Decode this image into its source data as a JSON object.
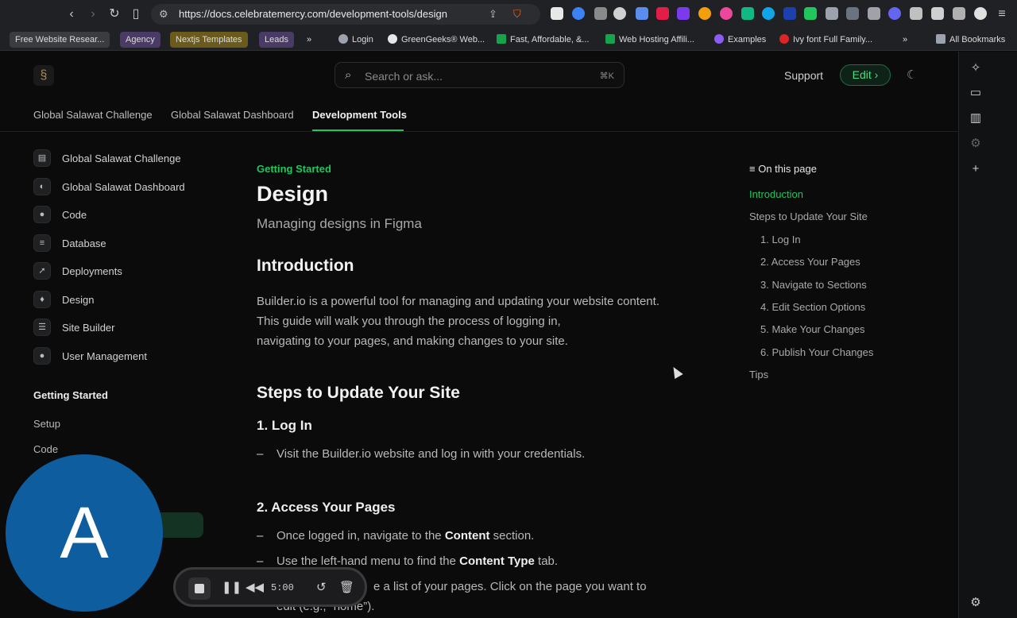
{
  "browser": {
    "url": "https://docs.celebratemercy.com/development-tools/design",
    "bookmarks": [
      {
        "label": "Free Website Resear...",
        "type": "tag",
        "color": "#3b3c40"
      },
      {
        "label": "Agency",
        "type": "tag",
        "color": "#4a3a66"
      },
      {
        "label": "Nextjs Templates",
        "type": "tag",
        "color": "#6a5a1c"
      },
      {
        "label": "Leads",
        "type": "tag",
        "color": "#4a3a66"
      },
      {
        "label": "Login",
        "type": "link",
        "icon": "globe-icon"
      },
      {
        "label": "GreenGeeks® Web...",
        "type": "link",
        "icon": "google-icon"
      },
      {
        "label": "Fast, Affordable, &...",
        "type": "link",
        "icon": "plus-green-icon"
      },
      {
        "label": "Web Hosting Affili...",
        "type": "link",
        "icon": "plus-green-icon"
      },
      {
        "label": "Examples",
        "type": "link",
        "icon": "purple-circle-icon"
      },
      {
        "label": "Ivy font Full Family...",
        "type": "link",
        "icon": "star-red-icon"
      },
      {
        "label": "All Bookmarks",
        "type": "folder"
      }
    ]
  },
  "header": {
    "search_placeholder": "Search or ask...",
    "search_shortcut": "⌘K",
    "support_label": "Support",
    "edit_label": "Edit ›"
  },
  "tabs": [
    {
      "label": "Global Salawat Challenge",
      "active": false
    },
    {
      "label": "Global Salawat Dashboard",
      "active": false
    },
    {
      "label": "Development Tools",
      "active": true
    }
  ],
  "sidebar": {
    "items": [
      {
        "label": "Global Salawat Challenge",
        "icon": "book-icon"
      },
      {
        "label": "Global Salawat Dashboard",
        "icon": "dashboard-icon"
      },
      {
        "label": "Code",
        "icon": "github-icon"
      },
      {
        "label": "Database",
        "icon": "database-icon"
      },
      {
        "label": "Deployments",
        "icon": "rocket-icon"
      },
      {
        "label": "Design",
        "icon": "droplet-icon"
      },
      {
        "label": "Site Builder",
        "icon": "sliders-icon"
      },
      {
        "label": "User Management",
        "icon": "user-icon"
      }
    ],
    "section_heading": "Getting Started",
    "section_items": [
      "Setup",
      "Code"
    ]
  },
  "main": {
    "breadcrumb": "Getting Started",
    "title": "Design",
    "subtitle": "Managing designs in Figma",
    "intro_heading": "Introduction",
    "intro_lines": [
      "Builder.io is a powerful tool for managing and updating your website content.",
      "This guide will walk you through the process of logging in,",
      "navigating to your pages, and making changes to your site."
    ],
    "steps_heading": "Steps to Update Your Site",
    "step1_heading": "1. Log In",
    "step1_bullet": "Visit the Builder.io website and log in with your credentials.",
    "step2_heading": "2. Access Your Pages",
    "step2_b1_pre": "Once logged in, navigate to the ",
    "step2_b1_bold": "Content",
    "step2_b1_post": " section.",
    "step2_b2_pre": "Use the left-hand menu to find the ",
    "step2_b2_bold": "Content Type",
    "step2_b2_post": " tab.",
    "step2_b3_line1": "e a list of your pages. Click on the page you want to",
    "step2_b3_line2": "edit (e.g., “home”)."
  },
  "toc": {
    "heading": "On this page",
    "items": [
      {
        "label": "Introduction",
        "level": 1,
        "active": true
      },
      {
        "label": "Steps to Update Your Site",
        "level": 1,
        "active": false
      },
      {
        "label": "1. Log In",
        "level": 2,
        "active": false
      },
      {
        "label": "2. Access Your Pages",
        "level": 2,
        "active": false
      },
      {
        "label": "3. Navigate to Sections",
        "level": 2,
        "active": false
      },
      {
        "label": "4. Edit Section Options",
        "level": 2,
        "active": false
      },
      {
        "label": "5. Make Your Changes",
        "level": 2,
        "active": false
      },
      {
        "label": "6. Publish Your Changes",
        "level": 2,
        "active": false
      },
      {
        "label": "Tips",
        "level": 1,
        "active": false
      }
    ]
  },
  "overlay": {
    "avatar_letter": "A",
    "recorder_time": "5:00"
  },
  "colors": {
    "accent": "#22c55e",
    "avatar": "#0e5d9e"
  }
}
